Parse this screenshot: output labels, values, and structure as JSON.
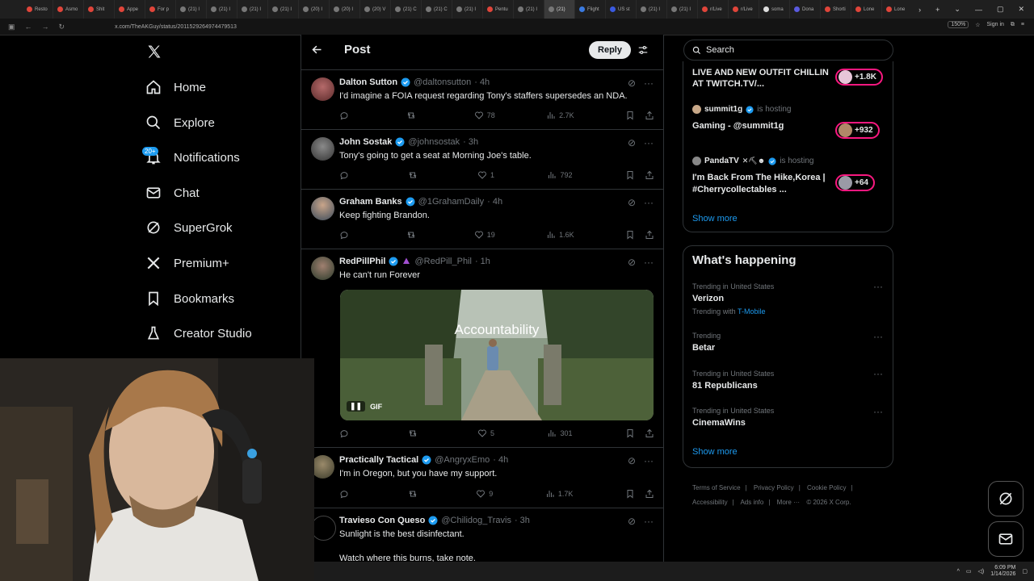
{
  "browser": {
    "tabs": [
      "Resto",
      "Asmo",
      "Shit",
      "Appe",
      "For p",
      "(21) I",
      "(21) I",
      "(21) I",
      "(21) I",
      "(20) I",
      "(20) I",
      "(20) V",
      "(21) C",
      "(21) C",
      "(21) I",
      "Pentu",
      "(21) I",
      "(21)",
      "Flight",
      "US st",
      "(21) I",
      "(21) I",
      "r/Live",
      "r/Live",
      "soma",
      "Dona",
      "Shorti",
      "Lone",
      "Lone"
    ],
    "url": "x.com/TheAKGuy/status/2011529264974479513",
    "zoom": "150%",
    "sign_in": "Sign in"
  },
  "nav": {
    "home": "Home",
    "explore": "Explore",
    "notifications": "Notifications",
    "notifications_badge": "20+",
    "chat": "Chat",
    "supergrok": "SuperGrok",
    "premium": "Premium+",
    "bookmarks": "Bookmarks",
    "creator_studio": "Creator Studio"
  },
  "header": {
    "title": "Post",
    "reply_button": "Reply"
  },
  "tweets": [
    {
      "name": "Dalton Sutton",
      "handle": "@daltonsutton",
      "time": "· 4h",
      "text": "I'd imagine a FOIA request regarding Tony's staffers supersedes an NDA.",
      "likes": "78",
      "views": "2.7K",
      "retweets": ""
    },
    {
      "name": "John Sostak",
      "handle": "@johnsostak",
      "time": "· 3h",
      "text": "Tony's going to get a seat at Morning Joe's table.",
      "likes": "1",
      "views": "792",
      "retweets": ""
    },
    {
      "name": "Graham Banks",
      "handle": "@1GrahamDaily",
      "time": "· 4h",
      "text": "Keep fighting Brandon.",
      "likes": "19",
      "views": "1.6K",
      "retweets": ""
    },
    {
      "name": "RedPillPhil",
      "handle": "@RedPill_Phil",
      "time": "· 1h",
      "text": "He can't run Forever",
      "likes": "5",
      "views": "301",
      "retweets": "",
      "gif_caption": "Accountability",
      "gif_label": "GIF"
    },
    {
      "name": "Practically Tactical",
      "handle": "@AngryxEmo",
      "time": "· 4h",
      "text": "I'm in Oregon, but you have my support.",
      "likes": "9",
      "views": "1.7K",
      "retweets": ""
    },
    {
      "name": "Travieso Con Queso",
      "handle": "@Chilidog_Travis",
      "time": "· 3h",
      "text": "Sunlight is the best disinfectant.",
      "text2": "Watch where this burns, take note."
    }
  ],
  "search": {
    "placeholder": "Search"
  },
  "live": {
    "item1_title": "LIVE AND NEW OUTFIT CHILLIN AT TWITCH.TV/...",
    "item1_count": "+1.8K",
    "item2_host": "summit1g",
    "item2_hosting": "is hosting",
    "item2_title": "Gaming - @summit1g",
    "item2_count": "+932",
    "item3_host": "PandaTV",
    "item3_hosting": "is hosting",
    "item3_title_1": "I'm Back From The Hike,Korea |",
    "item3_title_2": "#Cherrycollectables ...",
    "item3_count": "+64",
    "show_more": "Show more"
  },
  "trending": {
    "title": "What's happening",
    "items": [
      {
        "context": "Trending in United States",
        "name": "Verizon",
        "with_label": "Trending with",
        "with_value": "T-Mobile"
      },
      {
        "context": "Trending",
        "name": "Betar"
      },
      {
        "context": "Trending in United States",
        "name": "81 Republicans"
      },
      {
        "context": "Trending in United States",
        "name": "CinemaWins"
      }
    ],
    "show_more": "Show more"
  },
  "footer": [
    "Terms of Service",
    "|",
    "Privacy Policy",
    "|",
    "Cookie Policy",
    "|",
    "Accessibility",
    "|",
    "Ads info",
    "|",
    "More ···",
    "© 2026 X Corp."
  ],
  "taskbar": {
    "time": "6:09 PM",
    "date": "1/14/2026"
  },
  "colors": {
    "accent": "#1d9bf0",
    "live_pink": "#f91880",
    "background": "#000000",
    "muted": "#71767b"
  }
}
